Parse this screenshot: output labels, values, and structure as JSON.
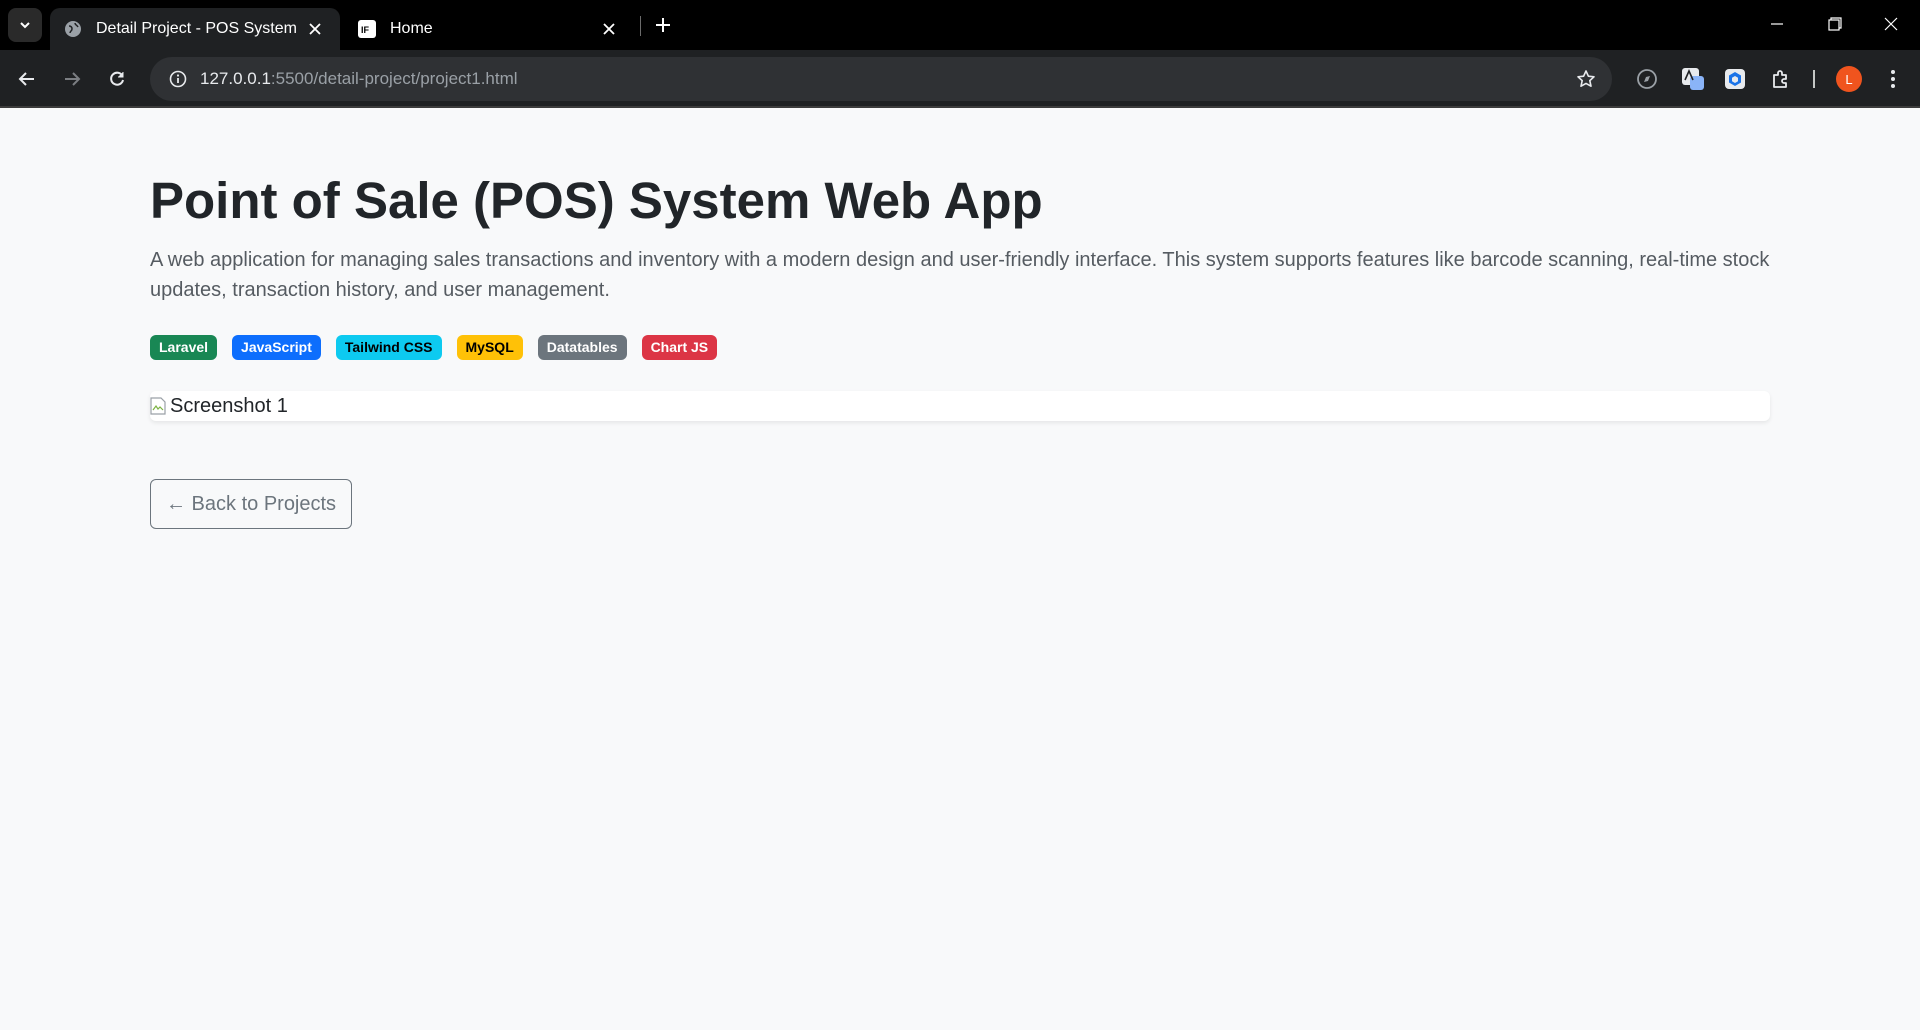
{
  "browser": {
    "tabs": [
      {
        "title": "Detail Project - POS System",
        "active": true
      },
      {
        "title": "Home",
        "active": false
      }
    ],
    "url": {
      "host": "127.0.0.1",
      "path": ":5500/detail-project/project1.html"
    },
    "profile_initial": "L"
  },
  "page": {
    "title": "Point of Sale (POS) System Web App",
    "description": "A web application for managing sales transactions and inventory with a modern design and user-friendly interface. This system supports features like barcode scanning, real-time stock updates, transaction history, and user management.",
    "badges": [
      {
        "label": "Laravel",
        "color": "#198754",
        "text_color": "#ffffff"
      },
      {
        "label": "JavaScript",
        "color": "#0d6efd",
        "text_color": "#ffffff"
      },
      {
        "label": "Tailwind CSS",
        "color": "#0dcaf0",
        "text_color": "#000000"
      },
      {
        "label": "MySQL",
        "color": "#ffc107",
        "text_color": "#000000"
      },
      {
        "label": "Datatables",
        "color": "#6c757d",
        "text_color": "#ffffff"
      },
      {
        "label": "Chart JS",
        "color": "#dc3545",
        "text_color": "#ffffff"
      }
    ],
    "screenshot_alt": "Screenshot 1",
    "back_label": "← Back to Projects"
  }
}
